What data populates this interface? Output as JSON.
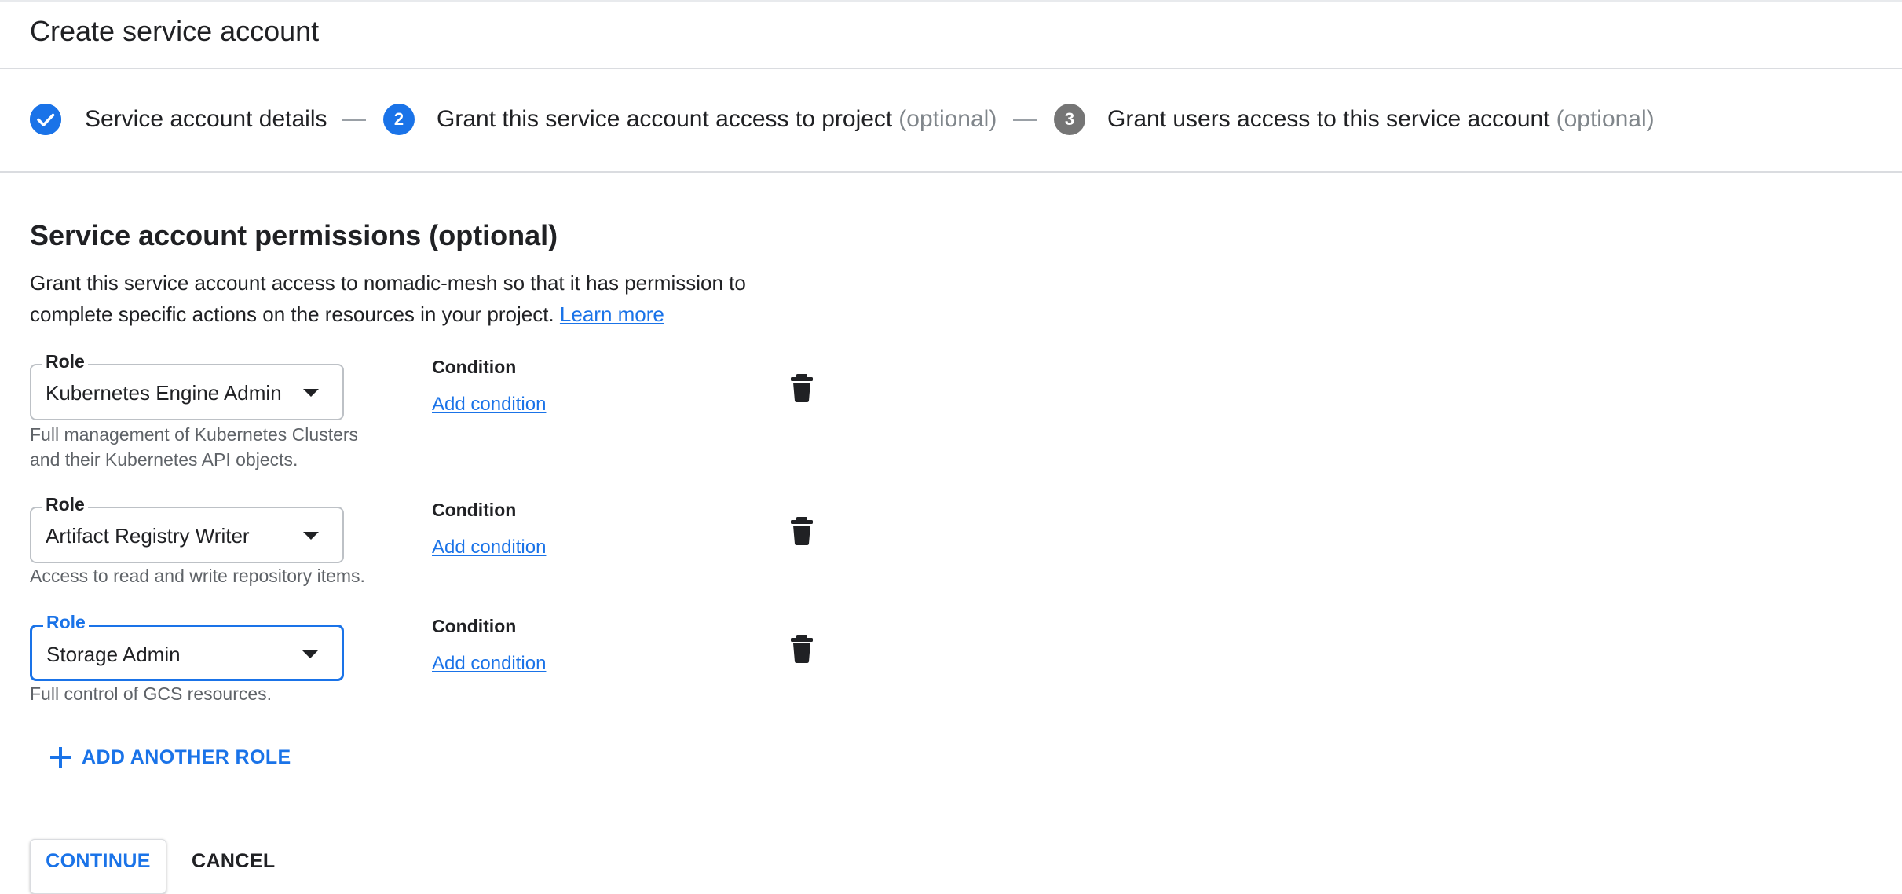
{
  "page": {
    "title": "Create service account"
  },
  "stepper": {
    "steps": [
      {
        "number": "",
        "label": "Service account details",
        "optional": "",
        "state": "completed"
      },
      {
        "number": "2",
        "label": "Grant this service account access to project",
        "optional": "(optional)",
        "state": "active"
      },
      {
        "number": "3",
        "label": "Grant users access to this service account",
        "optional": "(optional)",
        "state": "inactive"
      }
    ]
  },
  "permissions": {
    "title": "Service account permissions (optional)",
    "description_line1": "Grant this service account access to nomadic-mesh so that it has permission to",
    "description_line2": "complete specific actions on the resources in your project.",
    "learn_more": "Learn more",
    "roles": [
      {
        "field_label": "Role",
        "value": "Kubernetes Engine Admin",
        "help_line1": "Full management of Kubernetes Clusters",
        "help_line2": "and their Kubernetes API objects.",
        "condition_label": "Condition",
        "add_condition": "Add condition",
        "focused": false
      },
      {
        "field_label": "Role",
        "value": "Artifact Registry Writer",
        "help_line1": "Access to read and write repository items.",
        "help_line2": "",
        "condition_label": "Condition",
        "add_condition": "Add condition",
        "focused": false
      },
      {
        "field_label": "Role",
        "value": "Storage Admin",
        "help_line1": "Full control of GCS resources.",
        "help_line2": "",
        "condition_label": "Condition",
        "add_condition": "Add condition",
        "focused": true
      }
    ],
    "add_another_role": "ADD ANOTHER ROLE"
  },
  "actions": {
    "continue_label": "CONTINUE",
    "cancel_label": "CANCEL"
  },
  "colors": {
    "accent": "#1a73e8",
    "text": "#202124",
    "secondary_text": "#5f6368",
    "divider": "#dadce0",
    "inactive_step": "#757575"
  },
  "icons": {
    "completed_step": "check-circle-icon",
    "dropdown": "arrow-drop-down-icon",
    "delete": "trash-icon",
    "add": "plus-icon"
  }
}
